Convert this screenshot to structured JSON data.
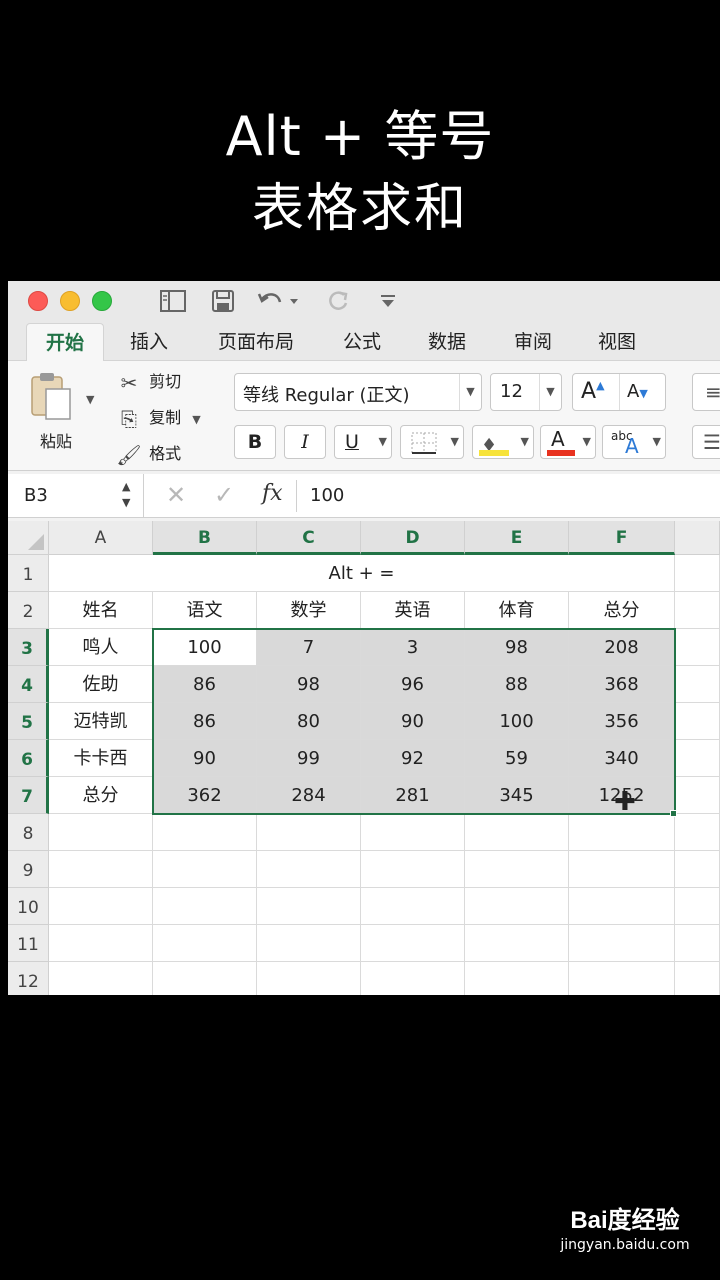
{
  "caption": {
    "line1": "Alt + 等号",
    "line2": "表格求和"
  },
  "titlebar": {
    "traffic_lights": [
      "close",
      "minimize",
      "zoom"
    ],
    "icons": [
      "sidebar-icon",
      "save-icon",
      "undo-icon",
      "redo-icon",
      "customize-toolbar-icon"
    ]
  },
  "tabs": [
    "开始",
    "插入",
    "页面布局",
    "公式",
    "数据",
    "审阅",
    "视图"
  ],
  "ribbon": {
    "paste": "粘贴",
    "cut": "剪切",
    "copy": "复制",
    "format": "格式",
    "font_name": "等线 Regular (正文)",
    "font_size": "12",
    "bold": "B",
    "italic": "I",
    "underline": "U",
    "font_color_glyph": "A",
    "phonetic_glyph": "abc",
    "grow_font": "A",
    "shrink_font": "A"
  },
  "formula_bar": {
    "name_box": "B3",
    "fx": "fx",
    "value": "100"
  },
  "grid": {
    "columns": [
      "A",
      "B",
      "C",
      "D",
      "E",
      "F"
    ],
    "rows": [
      "1",
      "2",
      "3",
      "4",
      "5",
      "6",
      "7",
      "8",
      "9",
      "10",
      "11",
      "12"
    ],
    "title_cell": "Alt + =",
    "header": [
      "姓名",
      "语文",
      "数学",
      "英语",
      "体育",
      "总分"
    ],
    "data": [
      [
        "鸣人",
        "100",
        "7",
        "3",
        "98",
        "208"
      ],
      [
        "佐助",
        "86",
        "98",
        "96",
        "88",
        "368"
      ],
      [
        "迈特凯",
        "86",
        "80",
        "90",
        "100",
        "356"
      ],
      [
        "卡卡西",
        "90",
        "99",
        "92",
        "59",
        "340"
      ],
      [
        "总分",
        "362",
        "284",
        "281",
        "345",
        "1252"
      ]
    ],
    "active_cell": "B3",
    "selection": "B3:F7"
  },
  "colors": {
    "accent": "#217346",
    "selection_fill": "#d9d9d9",
    "close": "#fc5b57",
    "minimize": "#f8bd30",
    "zoom": "#34c648"
  },
  "watermark": {
    "logo": "Bai度经验",
    "url": "jingyan.baidu.com"
  }
}
